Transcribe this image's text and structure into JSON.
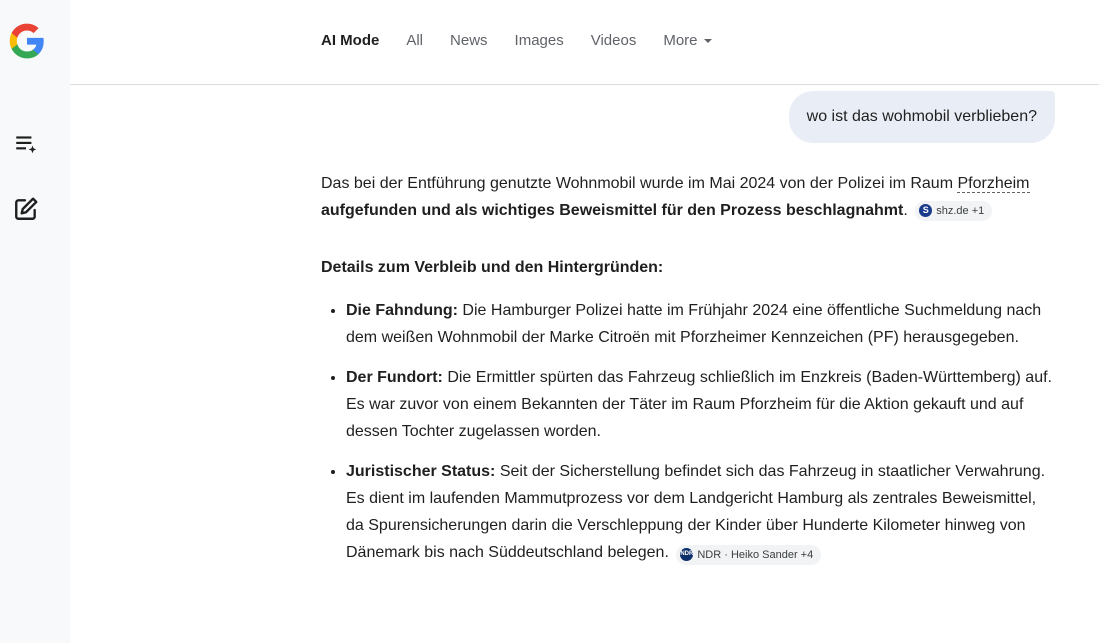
{
  "sidebar": {
    "logo_icon": "google-g-logo",
    "buttons": [
      {
        "icon": "playlist-add-icon"
      },
      {
        "icon": "edit-square-icon"
      }
    ]
  },
  "header": {
    "tabs": [
      {
        "label": "AI Mode",
        "active": true
      },
      {
        "label": "All"
      },
      {
        "label": "News"
      },
      {
        "label": "Images"
      },
      {
        "label": "Videos"
      },
      {
        "label": "More"
      }
    ]
  },
  "chat": {
    "user_message": "wo ist das wohmobil verblieben?",
    "answer": {
      "intro_part1": "Das bei der Entführung genutzte Wohnmobil wurde im Mai 2024 von der Polizei im Raum ",
      "intro_link": "Pforzheim",
      "intro_bold": " aufgefunden und als wichtiges Beweismittel für den Prozess beschlagnahmt",
      "intro_end": ".",
      "intro_source": "shz.de +1",
      "details_heading": "Details zum Verbleib und den Hintergründen:",
      "bullets": [
        {
          "title": "Die Fahndung:",
          "text": " Die Hamburger Polizei hatte im Frühjahr 2024 eine öffentliche Suchmeldung nach dem weißen Wohnmobil der Marke Citroën mit Pforzheimer Kennzeichen (PF) herausgegeben."
        },
        {
          "title": "Der Fundort:",
          "text": " Die Ermittler spürten das Fahrzeug schließlich im Enzkreis (Baden-Württemberg) auf. Es war zuvor von einem Bekannten der Täter im Raum Pforzheim für die Aktion gekauft und auf dessen Tochter zugelassen worden."
        },
        {
          "title": "Juristischer Status:",
          "text": " Seit der Sicherstellung befindet sich das Fahrzeug in staatlicher Verwahrung. Es dient im laufenden Mammutprozess vor dem Landgericht Hamburg als zentrales Beweismittel, da Spurensicherungen darin die Verschleppung der Kinder über Hunderte Kilometer hinweg von Dänemark bis nach Süddeutschland belegen.",
          "source": "NDR · Heiko Sander +4"
        }
      ]
    }
  },
  "colors": {
    "accent_blue": "#4285f4",
    "accent_red": "#ea4335",
    "accent_yellow": "#fbbc05",
    "accent_green": "#34a853",
    "bubble_bg": "#e9eef6",
    "sidebar_bg": "#f8f9fa"
  }
}
